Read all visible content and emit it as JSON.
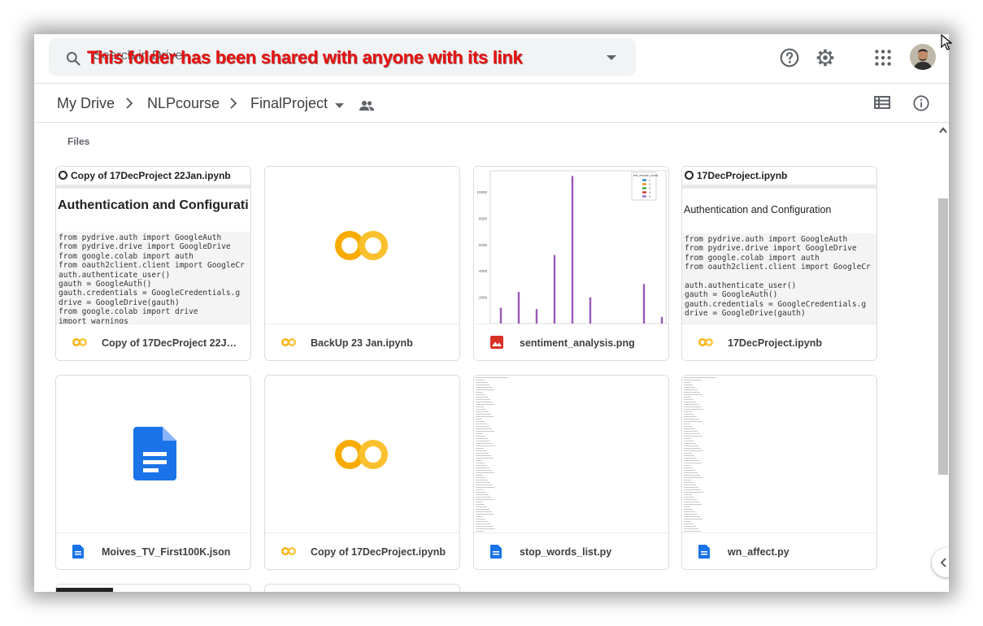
{
  "search": {
    "placeholder": "Search in Drive"
  },
  "banner": "This folder has been shared with anyone with its link",
  "breadcrumb": {
    "root": "My Drive",
    "parent": "NLPcourse",
    "current": "FinalProject"
  },
  "section_title": "Files",
  "icons": {
    "search": "search-icon",
    "help": "help-icon",
    "settings": "gear-icon",
    "apps": "apps-grid-icon",
    "shared": "shared-people-icon",
    "list_view": "list-view-icon",
    "info": "info-icon",
    "colab": "colab-icon",
    "image": "image-icon",
    "doc": "doc-icon"
  },
  "colors": {
    "banner": "#e81010",
    "colab_orange": "#f9ab00",
    "colab_yellow": "#fbc02d",
    "doc_blue": "#1a73e8",
    "image_red": "#d93025",
    "bars": "#9b59b6"
  },
  "files": [
    {
      "name": "Copy of 17DecProject 22Jan.ipynb",
      "icon": "colab",
      "thumb": {
        "title": "Copy of 17DecProject 22Jan.ipynb",
        "heading": "Authentication and Configurati",
        "code": [
          "from pydrive.auth import GoogleAuth",
          "from pydrive.drive import GoogleDrive",
          "from google.colab import auth",
          "from oauth2client.client import GoogleCr",
          "auth.authenticate_user()",
          "gauth = GoogleAuth()",
          "gauth.credentials = GoogleCredentials.g",
          "drive = GoogleDrive(gauth)",
          "from google.colab import drive",
          "import warnings"
        ]
      }
    },
    {
      "name": "BackUp 23 Jan.ipynb",
      "icon": "colab"
    },
    {
      "name": "sentiment_analysis.png",
      "icon": "image",
      "chart": {
        "ticks": [
          "2000",
          "4000",
          "6000",
          "8000",
          "10000"
        ],
        "legend_title": "text_emotion_words",
        "legend_items": [
          "1",
          "2",
          "3",
          "4",
          "5"
        ],
        "legend_colors": [
          "#1f77b4",
          "#ff7f0e",
          "#2ca02c",
          "#d62728",
          "#9467bd"
        ],
        "values": [
          1200,
          2400,
          1100,
          5200,
          11200,
          2000,
          3000,
          500
        ]
      }
    },
    {
      "name": "17DecProject.ipynb",
      "icon": "colab",
      "thumb": {
        "title": "17DecProject.ipynb",
        "heading": "Authentication and Configuration",
        "code": [
          "from pydrive.auth import GoogleAuth",
          "from pydrive.drive import GoogleDrive",
          "from google.colab import auth",
          "from oauth2client.client import GoogleCr",
          "",
          "auth.authenticate_user()",
          "gauth = GoogleAuth()",
          "gauth.credentials = GoogleCredentials.g",
          "drive = GoogleDrive(gauth)"
        ]
      }
    },
    {
      "name": "Moives_TV_First100K.json",
      "icon": "doc"
    },
    {
      "name": "Copy of 17DecProject.ipynb",
      "icon": "colab"
    },
    {
      "name": "stop_words_list.py",
      "icon": "doc"
    },
    {
      "name": "wn_affect.py",
      "icon": "doc"
    }
  ]
}
